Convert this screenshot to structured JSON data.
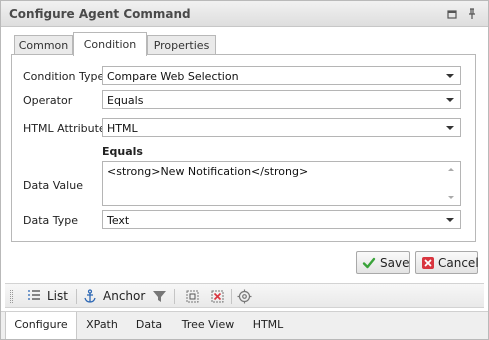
{
  "window": {
    "title": "Configure Agent Command"
  },
  "top_tabs": [
    {
      "label": "Common"
    },
    {
      "label": "Condition"
    },
    {
      "label": "Properties"
    }
  ],
  "form": {
    "condition_type_label": "Condition Type",
    "condition_type_value": "Compare Web Selection",
    "operator_label": "Operator",
    "operator_value": "Equals",
    "html_attribute_label": "HTML Attribute",
    "html_attribute_value": "HTML",
    "equals_caption": "Equals",
    "data_value_label": "Data Value",
    "data_value_value": "<strong>New Notification</strong>",
    "data_type_label": "Data Type",
    "data_type_value": "Text"
  },
  "buttons": {
    "save": "Save",
    "cancel": "Cancel"
  },
  "toolbar": {
    "list": "List",
    "anchor": "Anchor"
  },
  "bottom_tabs": [
    {
      "label": "Configure"
    },
    {
      "label": "XPath"
    },
    {
      "label": "Data"
    },
    {
      "label": "Tree View"
    },
    {
      "label": "HTML"
    }
  ],
  "colors": {
    "save_check": "#3aa33a",
    "cancel_x": "#d9353f",
    "anchor_icon": "#2b66b4"
  }
}
